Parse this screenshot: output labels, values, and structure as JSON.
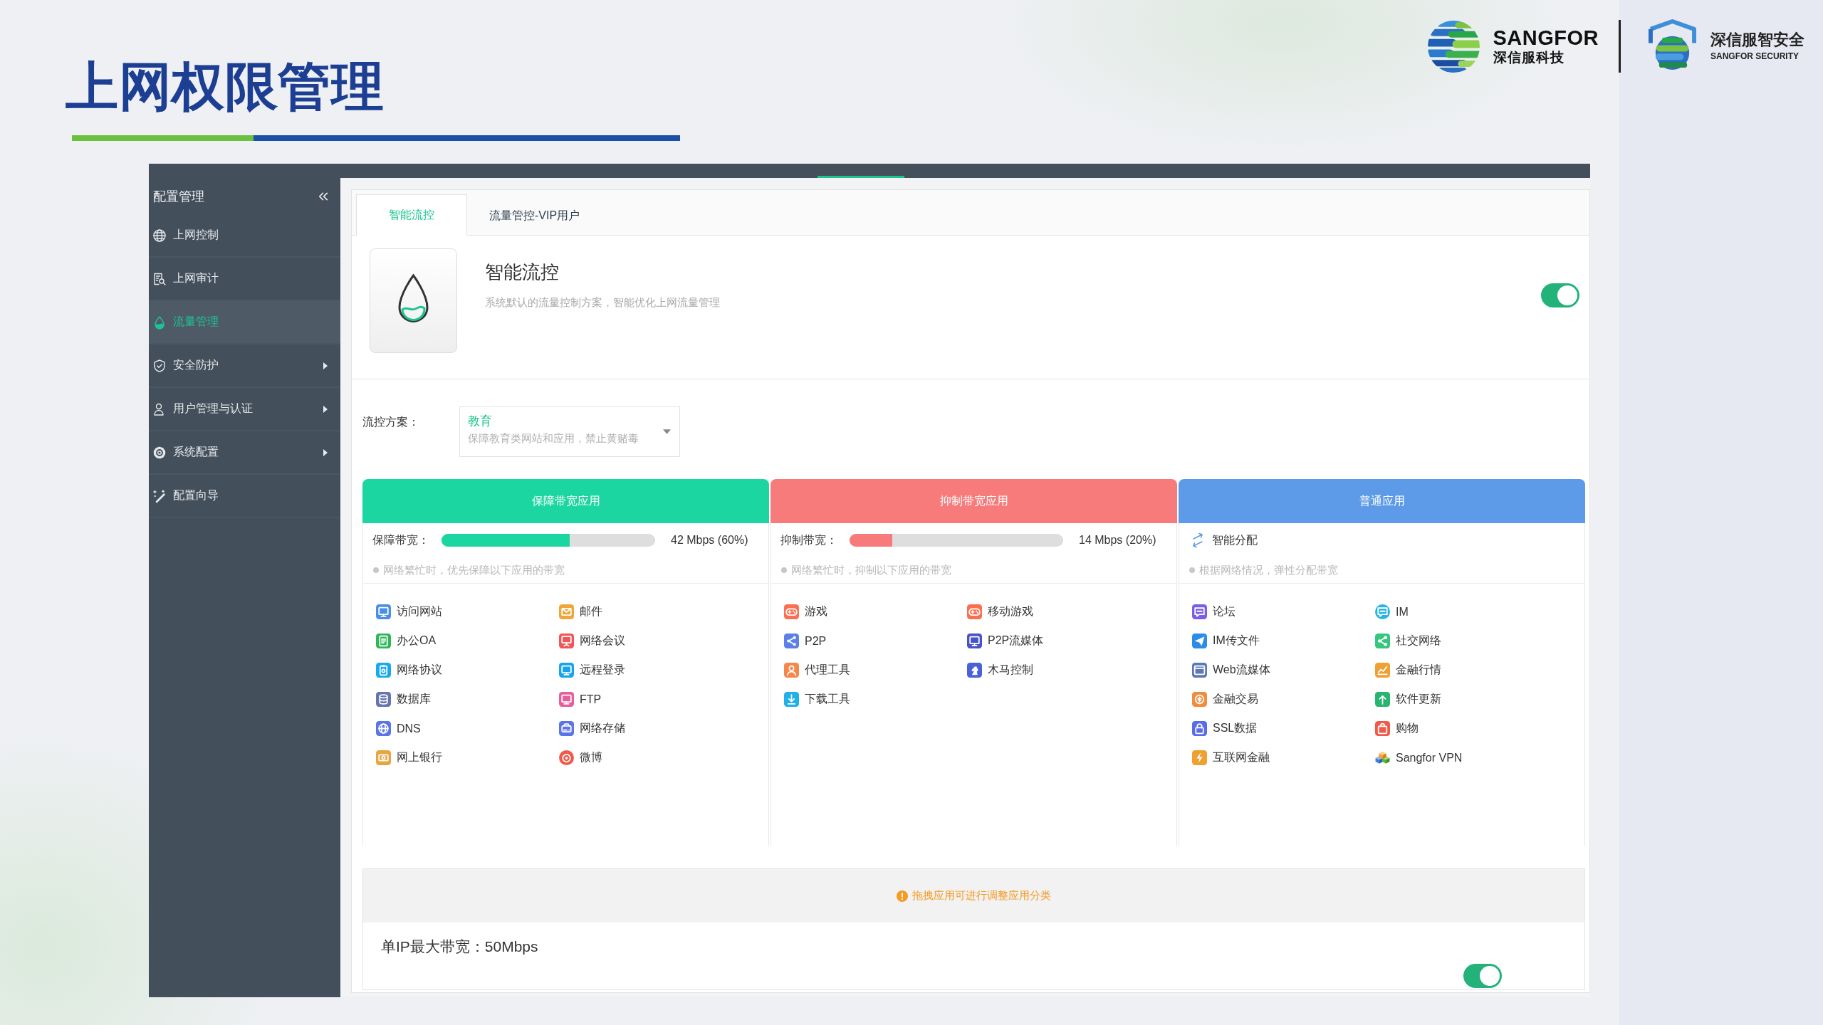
{
  "slide": {
    "title": "上网权限管理"
  },
  "logos": [
    {
      "name": "SANGFOR",
      "subtitle": "深信服科技"
    },
    {
      "name": "深信服智安全",
      "subtitle": "SANGFOR SECURITY"
    }
  ],
  "sidebar": {
    "title": "配置管理",
    "items": [
      {
        "label": "上网控制",
        "selected": false,
        "has_submenu": false
      },
      {
        "label": "上网审计",
        "selected": false,
        "has_submenu": false
      },
      {
        "label": "流量管理",
        "selected": true,
        "has_submenu": false
      },
      {
        "label": "安全防护",
        "selected": false,
        "has_submenu": true
      },
      {
        "label": "用户管理与认证",
        "selected": false,
        "has_submenu": true
      },
      {
        "label": "系统配置",
        "selected": false,
        "has_submenu": true
      },
      {
        "label": "配置向导",
        "selected": false,
        "has_submenu": false
      }
    ]
  },
  "tabs": [
    {
      "label": "智能流控",
      "selected": true
    },
    {
      "label": "流量管控-VIP用户",
      "selected": false
    }
  ],
  "feature": {
    "title": "智能流控",
    "description": "系统默认的流量控制方案，智能优化上网流量管理",
    "on": true
  },
  "scheme": {
    "label": "流控方案：",
    "value": "教育",
    "description": "保障教育类网站和应用，禁止黄赌毒"
  },
  "categories": [
    {
      "title": "保障带宽应用",
      "kind": "bandwidth",
      "color": "#1bd6a0",
      "bandwidth_label": "保障带宽：",
      "level": 0.6,
      "reading": "42 Mbps (60%)",
      "hint": "网络繁忙时，优先保障以下应用的带宽",
      "apps": [
        "访问网站",
        "邮件",
        "办公OA",
        "网络会议",
        "网络协议",
        "远程登录",
        "数据库",
        "FTP",
        "DNS",
        "网络存储",
        "网上银行",
        "微博"
      ]
    },
    {
      "title": "抑制带宽应用",
      "kind": "bandwidth",
      "color": "#f77b7b",
      "bandwidth_label": "抑制带宽：",
      "level": 0.2,
      "reading": "14 Mbps (20%)",
      "hint": "网络繁忙时，抑制以下应用的带宽",
      "apps": [
        "游戏",
        "移动游戏",
        "P2P",
        "P2P流媒体",
        "代理工具",
        "木马控制",
        "下载工具"
      ]
    },
    {
      "title": "普通应用",
      "kind": "auto",
      "color": "#5d9be8",
      "mode_label": "智能分配",
      "hint": "根据网络情况，弹性分配带宽",
      "apps": [
        "论坛",
        "IM",
        "IM传文件",
        "社交网络",
        "Web流媒体",
        "金融行情",
        "金融交易",
        "软件更新",
        "SSL数据",
        "购物",
        "互联网金融",
        "Sangfor VPN"
      ]
    }
  ],
  "notice": "拖拽应用可进行调整应用分类",
  "per_ip_limit": {
    "label": "单IP最大带宽：50Mbps",
    "on": true
  }
}
